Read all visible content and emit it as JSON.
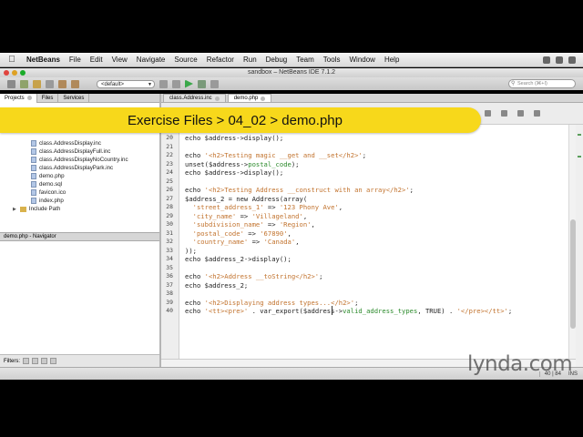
{
  "menubar": {
    "app": "NetBeans",
    "items": [
      "File",
      "Edit",
      "View",
      "Navigate",
      "Source",
      "Refactor",
      "Run",
      "Debug",
      "Team",
      "Tools",
      "Window",
      "Help"
    ]
  },
  "window": {
    "title": "sandbox – NetBeans IDE 7.1.2"
  },
  "toolbar": {
    "config": "<default>",
    "search_placeholder": "Search (⌘+I)"
  },
  "left_panel": {
    "tabs": [
      "Projects",
      "Files",
      "Services"
    ],
    "items": [
      "class.AddressDisplay.inc",
      "class.AddressDisplayFull.inc",
      "class.AddressDisplayNoCountry.inc",
      "class.AddressDisplayPark.inc",
      "demo.php",
      "demo.sql",
      "favicon.ico",
      "index.php"
    ],
    "folder": "Include Path",
    "navigator_title": "demo.php - Navigator",
    "filters_label": "Filters:"
  },
  "editor": {
    "tabs": [
      "class.Address.inc",
      "demo.php"
    ],
    "line_numbers": [
      "20",
      "21",
      "22",
      "23",
      "24",
      "25",
      "26",
      "27",
      "28",
      "29",
      "30",
      "31",
      "32",
      "33",
      "34",
      "35",
      "36",
      "37",
      "38",
      "39",
      "40"
    ],
    "lines": [
      [
        [
          "tk-plain",
          "echo $address->display();"
        ]
      ],
      [],
      [
        [
          "tk-plain",
          "echo "
        ],
        [
          "tk-str",
          "'<h2>Testing magic __get and __set</h2>'"
        ],
        [
          "tk-plain",
          ";"
        ]
      ],
      [
        [
          "tk-plain",
          "unset($address->"
        ],
        [
          "tk-prop",
          "postal_code"
        ],
        [
          "tk-plain",
          ");"
        ]
      ],
      [
        [
          "tk-plain",
          "echo $address->display();"
        ]
      ],
      [],
      [
        [
          "tk-plain",
          "echo "
        ],
        [
          "tk-str",
          "'<h2>Testing Address __construct with an array</h2>'"
        ],
        [
          "tk-plain",
          ";"
        ]
      ],
      [
        [
          "tk-plain",
          "$address_2 = new Address(array("
        ]
      ],
      [
        [
          "tk-plain",
          "  "
        ],
        [
          "tk-str",
          "'street_address_1'"
        ],
        [
          "tk-plain",
          " => "
        ],
        [
          "tk-str",
          "'123 Phony Ave'"
        ],
        [
          "tk-plain",
          ","
        ]
      ],
      [
        [
          "tk-plain",
          "  "
        ],
        [
          "tk-str",
          "'city_name'"
        ],
        [
          "tk-plain",
          " => "
        ],
        [
          "tk-str",
          "'Villageland'"
        ],
        [
          "tk-plain",
          ","
        ]
      ],
      [
        [
          "tk-plain",
          "  "
        ],
        [
          "tk-str",
          "'subdivision_name'"
        ],
        [
          "tk-plain",
          " => "
        ],
        [
          "tk-str",
          "'Region'"
        ],
        [
          "tk-plain",
          ","
        ]
      ],
      [
        [
          "tk-plain",
          "  "
        ],
        [
          "tk-str",
          "'postal_code'"
        ],
        [
          "tk-plain",
          " => "
        ],
        [
          "tk-str",
          "'67890'"
        ],
        [
          "tk-plain",
          ","
        ]
      ],
      [
        [
          "tk-plain",
          "  "
        ],
        [
          "tk-str",
          "'country_name'"
        ],
        [
          "tk-plain",
          " => "
        ],
        [
          "tk-str",
          "'Canada'"
        ],
        [
          "tk-plain",
          ","
        ]
      ],
      [
        [
          "tk-plain",
          "));"
        ]
      ],
      [
        [
          "tk-plain",
          "echo $address_2->display();"
        ]
      ],
      [],
      [
        [
          "tk-plain",
          "echo "
        ],
        [
          "tk-str",
          "'<h2>Address __toString</h2>'"
        ],
        [
          "tk-plain",
          ";"
        ]
      ],
      [
        [
          "tk-plain",
          "echo $address_2;"
        ]
      ],
      [],
      [
        [
          "tk-plain",
          "echo "
        ],
        [
          "tk-str",
          "'<h2>Displaying address types...</h2>'"
        ],
        [
          "tk-plain",
          ";"
        ]
      ],
      [
        [
          "tk-plain",
          "echo "
        ],
        [
          "tk-str",
          "'<tt><pre>'"
        ],
        [
          "tk-plain",
          " . var_export($address->"
        ],
        [
          "tk-prop",
          "valid_address_types"
        ],
        [
          "tk-plain",
          ", TRUE) . "
        ],
        [
          "tk-str",
          "'</pre></tt>'"
        ],
        [
          "tk-plain",
          ";"
        ]
      ]
    ]
  },
  "status": {
    "cursor": "40 | 84",
    "mode": "INS"
  },
  "overlay": {
    "breadcrumb": "Exercise Files > 04_02 > demo.php",
    "watermark": "lynda.com"
  },
  "colors": {
    "banner": "#f7d81b",
    "keyword": "#1a1a9a",
    "string": "#c2732e",
    "property": "#2b8a2b"
  }
}
